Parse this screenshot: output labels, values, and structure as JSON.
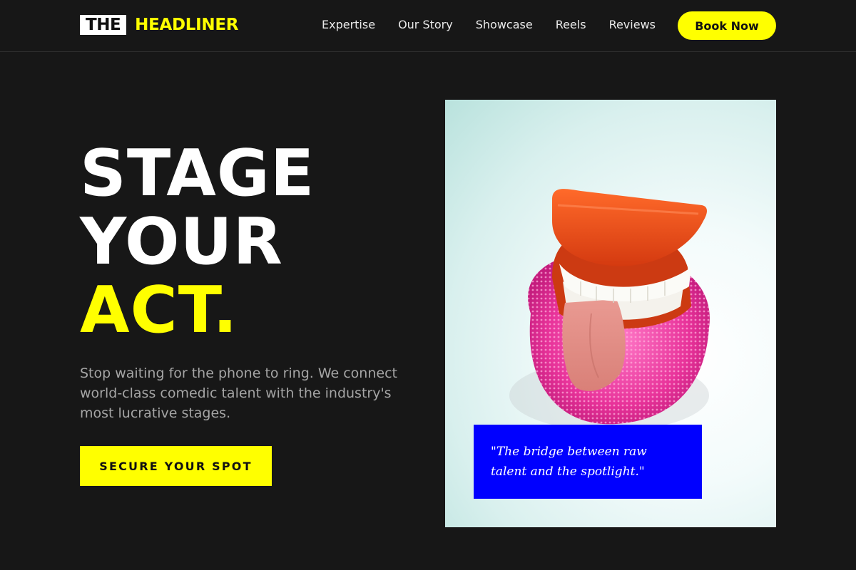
{
  "brand": {
    "box_text": "THE",
    "word_text": "HEADLINER",
    "accent_color": "#ffff00"
  },
  "nav": {
    "links": [
      "Expertise",
      "Our Story",
      "Showcase",
      "Reels",
      "Reviews"
    ],
    "book_label": "Book Now"
  },
  "hero": {
    "headline_line1": "STAGE",
    "headline_line2": "YOUR",
    "headline_line3": "ACT.",
    "description": "Stop waiting for the phone to ring. We connect world-class comedic talent with the industry's most lucrative stages.",
    "cta_label": "SECURE YOUR SPOT"
  },
  "image": {
    "subject": "wind-up chattering teeth toy on pink scrubber",
    "quote": "\"The bridge between raw talent and the spotlight.\"",
    "quote_box_color": "#0000ff"
  }
}
